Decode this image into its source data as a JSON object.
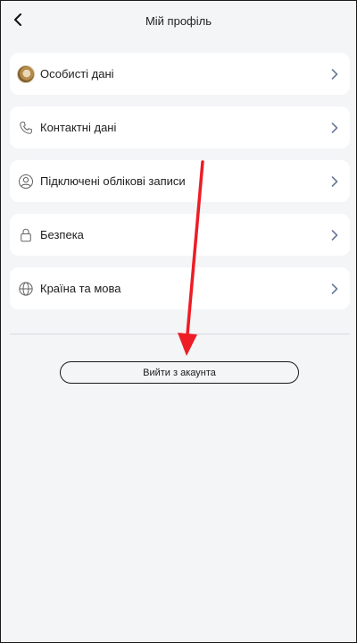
{
  "header": {
    "title": "Мій профіль",
    "back_icon": "chevron-left-icon"
  },
  "menu": [
    {
      "id": "personal",
      "label": "Особисті дані",
      "icon": "avatar"
    },
    {
      "id": "contacts",
      "label": "Контактні дані",
      "icon": "phone-icon"
    },
    {
      "id": "connected",
      "label": "Підключені облікові записи",
      "icon": "user-circle-icon"
    },
    {
      "id": "security",
      "label": "Безпека",
      "icon": "lock-icon"
    },
    {
      "id": "country",
      "label": "Країна та мова",
      "icon": "globe-icon"
    }
  ],
  "logout": {
    "label": "Вийти з акаунта"
  },
  "colors": {
    "background": "#f4f5f7",
    "card": "#ffffff",
    "annotation": "#ee1c25"
  }
}
